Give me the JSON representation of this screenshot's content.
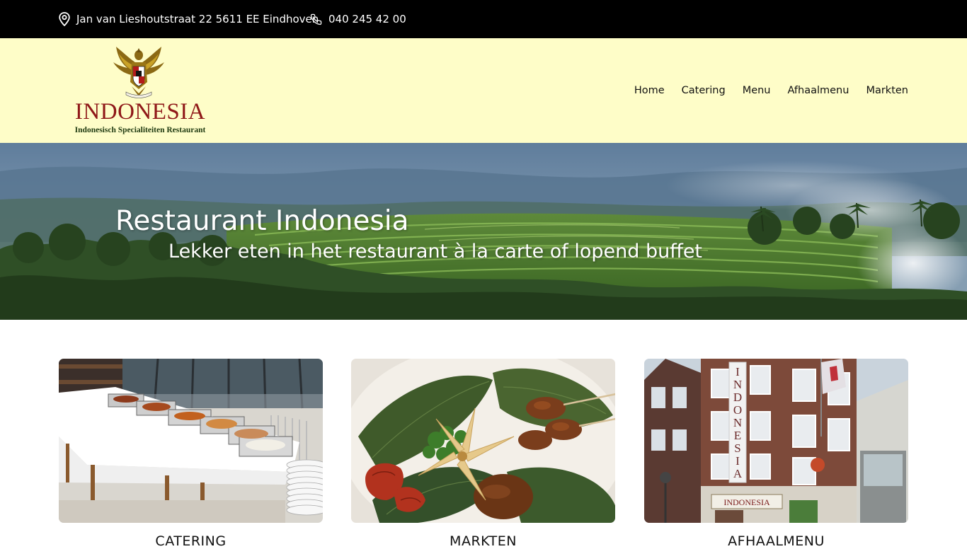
{
  "topbar": {
    "address": "Jan van Lieshoutstraat 22 5611 EE Eindhoven",
    "phone": "040 245 42 00",
    "address_icon": "map-pin-icon",
    "phone_icon": "phone-icon"
  },
  "logo": {
    "brand": "INDONESIA",
    "tagline": "Indonesisch Specialiteiten Restaurant"
  },
  "nav": {
    "items": [
      {
        "label": "Home"
      },
      {
        "label": "Catering"
      },
      {
        "label": "Menu"
      },
      {
        "label": "Afhaalmenu"
      },
      {
        "label": "Markten"
      }
    ]
  },
  "hero": {
    "title": "Restaurant Indonesia",
    "subtitle": "Lekker eten in het restaurant à la carte of lopend buffet"
  },
  "cards": [
    {
      "title": "CATERING"
    },
    {
      "title": "MARKTEN"
    },
    {
      "title": "AFHAALMENU"
    }
  ],
  "colors": {
    "topbar_bg": "#000000",
    "header_bg": "#fefdc8",
    "brand_red": "#8f1818"
  }
}
